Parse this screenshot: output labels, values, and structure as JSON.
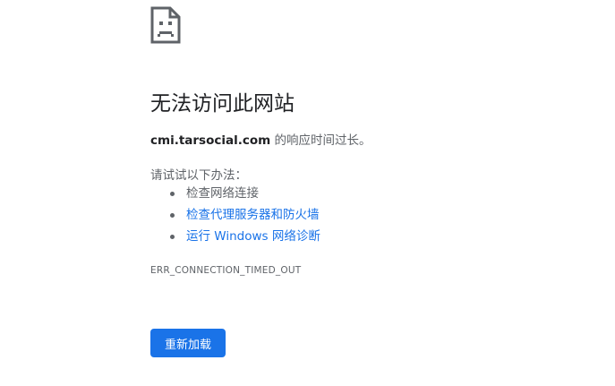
{
  "error_page": {
    "icon": "sad-page-icon",
    "title": "无法访问此网站",
    "host": "cmi.tarsocial.com",
    "message_suffix": " 的响应时间过长。",
    "suggestions_heading": "请试试以下办法：",
    "suggestions": [
      {
        "label": "检查网络连接",
        "is_link": false
      },
      {
        "label": "检查代理服务器和防火墙",
        "is_link": true
      },
      {
        "label": "运行 Windows 网络诊断",
        "is_link": true
      }
    ],
    "error_code": "ERR_CONNECTION_TIMED_OUT",
    "reload_label": "重新加载"
  },
  "colors": {
    "accent": "#1a73e8",
    "text_primary": "#202124",
    "text_secondary": "#5f6368",
    "background": "#ffffff"
  }
}
